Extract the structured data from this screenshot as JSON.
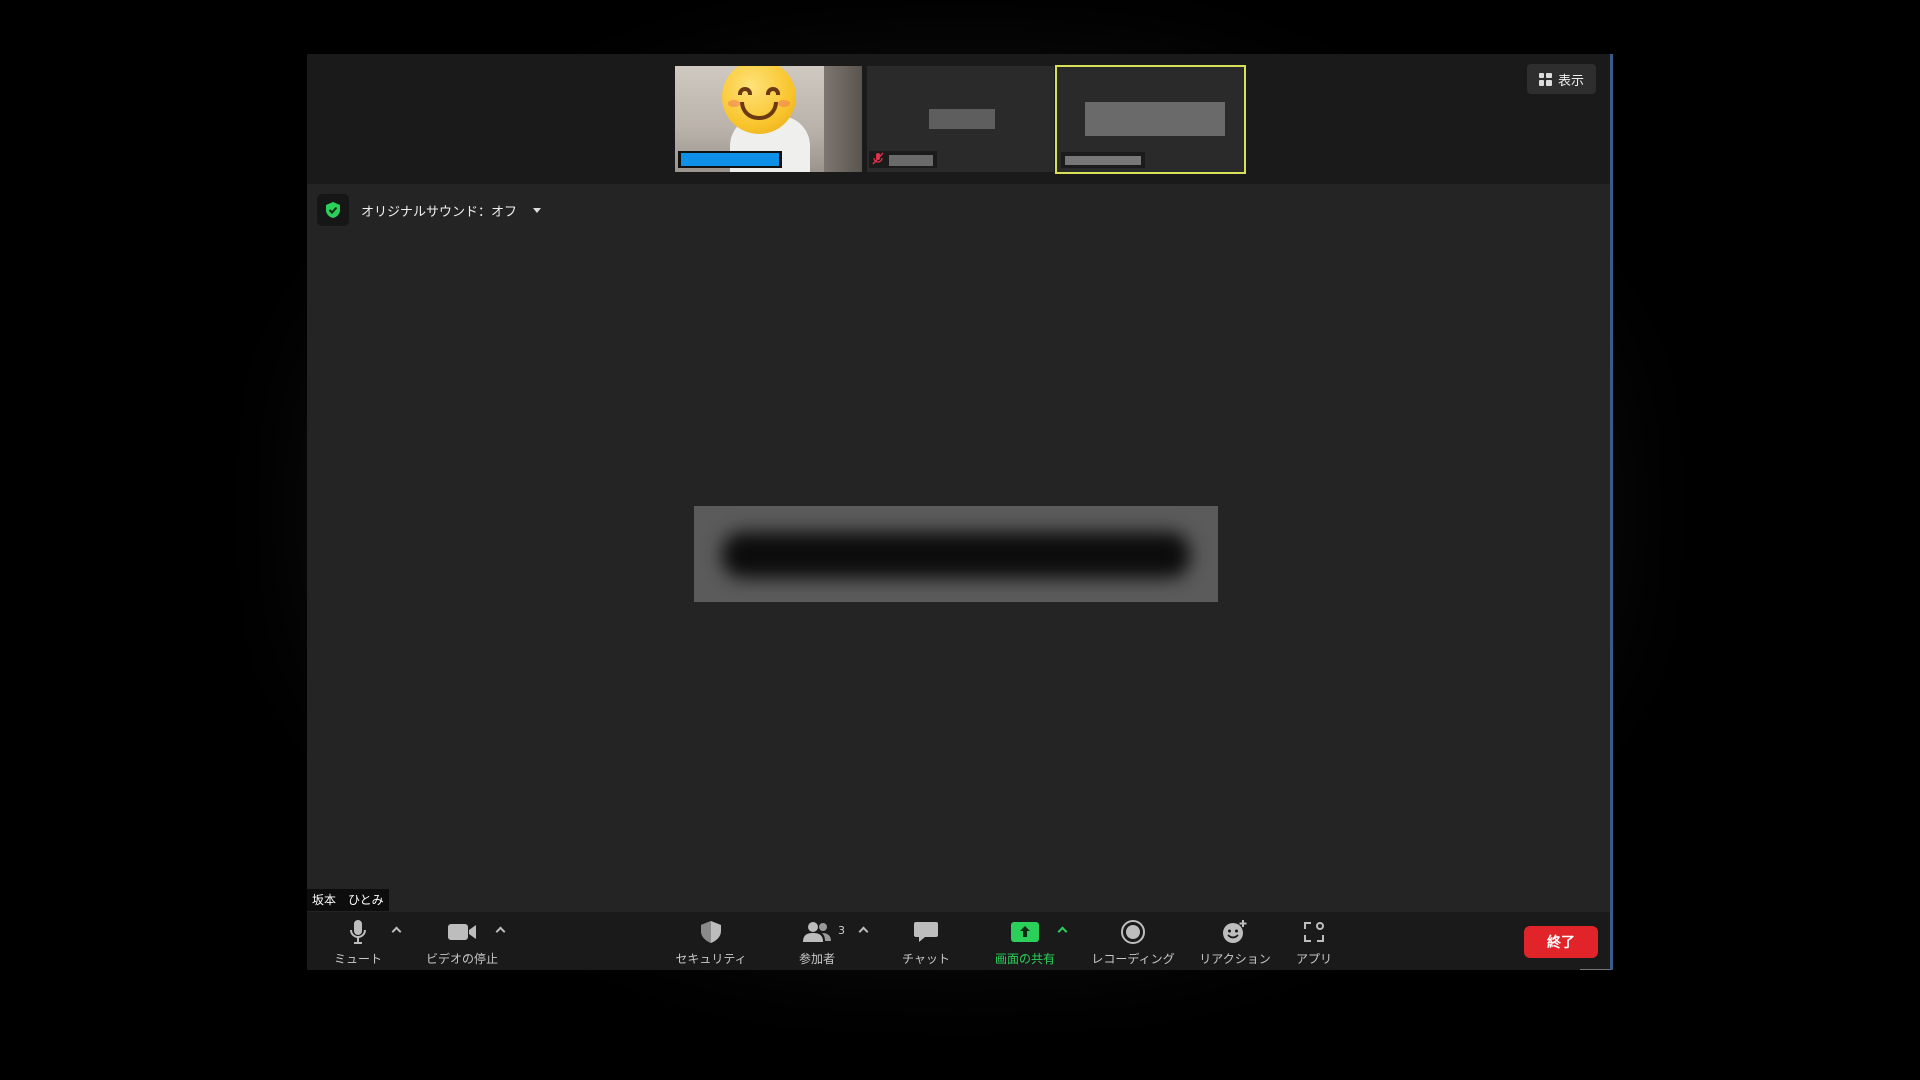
{
  "topbar": {
    "view_label": "表示"
  },
  "sound": {
    "label": "オリジナルサウンド：オフ"
  },
  "speaker": {
    "name": "坂本　ひとみ"
  },
  "toolbar": {
    "mute": "ミュート",
    "video_stop": "ビデオの停止",
    "security": "セキュリティ",
    "participants": "参加者",
    "participants_count": "3",
    "chat": "チャット",
    "share_screen": "画面の共有",
    "recording": "レコーディング",
    "reaction": "リアクション",
    "apps": "アプリ",
    "end": "終了"
  },
  "colors": {
    "accent_green": "#2bd05a",
    "end_red": "#e0242a",
    "active_speaker_border": "#d8e05a",
    "name_highlight": "#0e8fe8"
  }
}
